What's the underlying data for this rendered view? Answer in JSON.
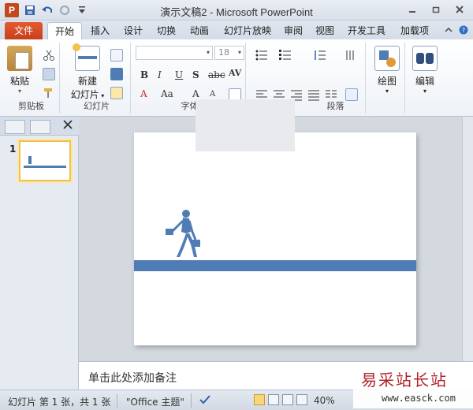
{
  "window": {
    "title": "演示文稿2 - Microsoft PowerPoint",
    "app_icon_letter": "P",
    "controls": [
      "minimize-icon",
      "restore-icon",
      "close-icon"
    ]
  },
  "quick_access": [
    "save-icon",
    "undo-icon",
    "redo-icon",
    "customize-qat-icon"
  ],
  "ribbon_tabs": [
    "文件",
    "开始",
    "插入",
    "设计",
    "切换",
    "动画",
    "幻灯片放映",
    "审阅",
    "视图",
    "开发工具",
    "加载项"
  ],
  "active_tab": "开始",
  "ribbon": {
    "clipboard": {
      "label": "剪贴板",
      "paste": "粘贴"
    },
    "slides": {
      "label": "幻灯片",
      "new_slide_line1": "新建",
      "new_slide_line2": "幻灯片"
    },
    "font": {
      "label": "字体",
      "font_name": "",
      "font_size": "18"
    },
    "paragraph": {
      "label": "段落"
    },
    "drawing": {
      "label": "绘图"
    },
    "editing": {
      "label": "编辑"
    }
  },
  "slide_panel": {
    "slide_number": "1"
  },
  "notes": {
    "placeholder": "单击此处添加备注"
  },
  "status": {
    "slide_info": "幻灯片 第 1 张，共 1 张",
    "theme": "\"Office 主题\"",
    "zoom": "40%"
  },
  "watermark": {
    "title": "易采站长站",
    "url": "www.easck.com"
  },
  "colors": {
    "accent_band": "#4f7cb4",
    "file_tab": "#c6401b",
    "thumb_border": "#f2c14a"
  }
}
